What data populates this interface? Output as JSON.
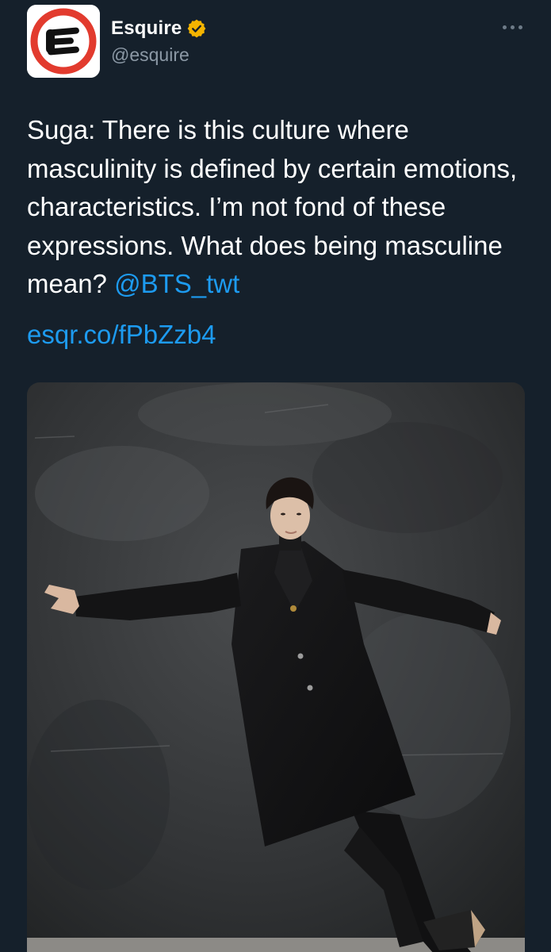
{
  "author": {
    "display_name": "Esquire",
    "handle": "@esquire",
    "avatar_letter": "E",
    "verified_icon": "verified-badge-icon",
    "verified_color": "#f4b400"
  },
  "tweet": {
    "text": "Suga: There is this culture where masculinity is defined by certain emotions, characteristics. I’m not fond of these expressions. What does being masculine mean? ",
    "mention": "@BTS_twt",
    "link": "esqr.co/fPbZzb4"
  },
  "colors": {
    "background": "#15202b",
    "accent": "#1d9bf0",
    "secondary_text": "#8b98a5",
    "avatar_ring": "#e23b2e"
  },
  "more_icon": "more-options-icon"
}
